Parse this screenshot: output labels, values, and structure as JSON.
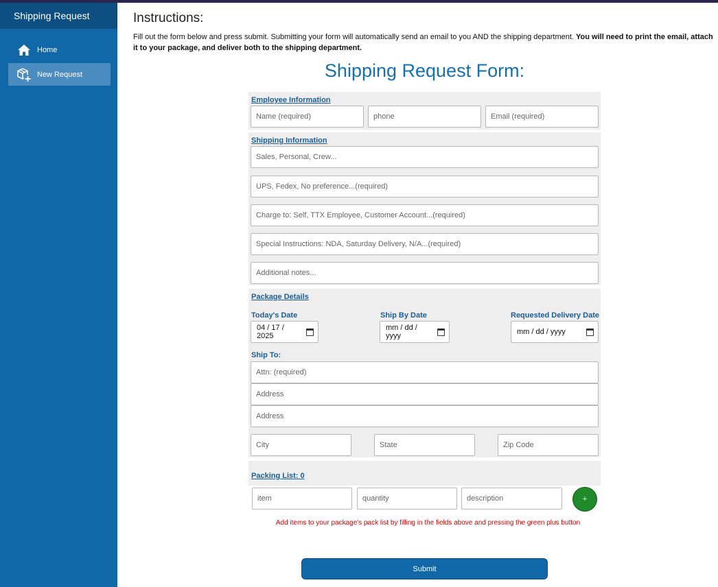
{
  "sidebar": {
    "title": "Shipping Request",
    "items": [
      {
        "label": "Home",
        "icon": "home-icon"
      },
      {
        "label": "New Request",
        "icon": "add-package-icon"
      }
    ]
  },
  "instructions": {
    "title": "Instructions:",
    "text_normal": "Fill out the form below and press submit. Submitting your form will automatically send an email to you AND the shipping department. ",
    "text_bold": "You will need to print the email, attach it to your package, and deliver both to the shipping department."
  },
  "form": {
    "title": "Shipping Request Form:",
    "employee": {
      "section_title": "Employee Information",
      "name_placeholder": "Name (required)",
      "phone_placeholder": "phone",
      "email_placeholder": "Email (required)"
    },
    "shipping": {
      "section_title": "Shipping Information",
      "type_placeholder": "Sales, Personal, Crew...",
      "carrier_placeholder": "UPS, Fedex, No preference...(required)",
      "charge_placeholder": "Charge to: Self, TTX Employee, Customer Account...(required)",
      "special_placeholder": "Special Instructions: NDA, Saturday Delivery, N/A...(required)",
      "notes_placeholder": "Additional notes..."
    },
    "package": {
      "section_title": "Package Details",
      "today_label": "Today's Date",
      "today_value": "04 / 17 / 2025",
      "ship_by_label": "Ship By Date",
      "ship_by_value": "mm / dd / yyyy",
      "delivery_label": "Requested Delivery Date",
      "delivery_value": "mm / dd / yyyy",
      "ship_to_label": "Ship To:",
      "attn_placeholder": "Attn: (required)",
      "address1_placeholder": "Address",
      "address2_placeholder": "Address",
      "city_placeholder": "City",
      "state_placeholder": "State",
      "zip_placeholder": "Zip Code"
    },
    "packing": {
      "section_title": "Packing List: 0",
      "item_placeholder": "item",
      "quantity_placeholder": "quantity",
      "description_placeholder": "description",
      "add_label": "+",
      "hint": "Add items to your package's pack list by filling in the fields above and pressing the green plus button"
    },
    "submit_label": "Submit"
  },
  "colors": {
    "sidebar": "#1068a8",
    "accent": "#1570b0",
    "add_button": "#1f8a2a",
    "hint": "#e00000"
  }
}
